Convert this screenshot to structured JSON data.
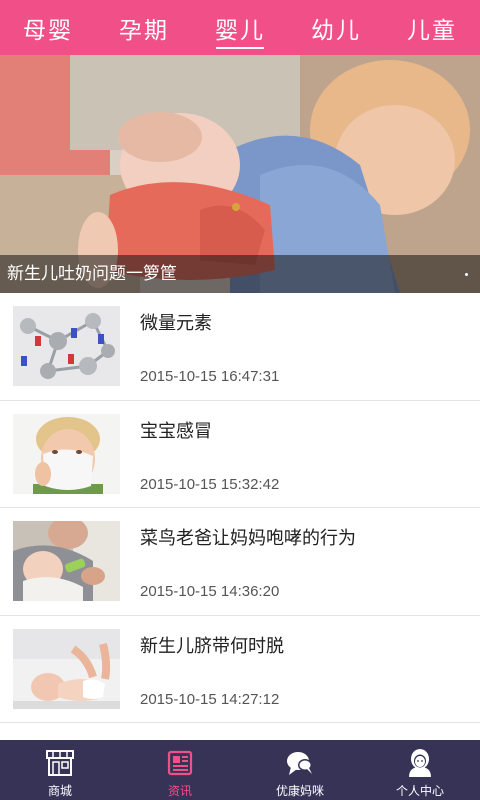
{
  "top_tabs": [
    {
      "label": "母婴"
    },
    {
      "label": "孕期"
    },
    {
      "label": "婴儿"
    },
    {
      "label": "幼儿"
    },
    {
      "label": "儿童"
    }
  ],
  "active_top_tab": "婴儿",
  "hero": {
    "caption": "新生儿吐奶问题一箩筐",
    "slide_indicator": "•"
  },
  "articles": [
    {
      "title": "微量元素",
      "time": "2015-10-15 16:47:31",
      "thumb_icon": "molecule-model-image"
    },
    {
      "title": "宝宝感冒",
      "time": "2015-10-15 15:32:42",
      "thumb_icon": "child-blowing-nose-image"
    },
    {
      "title": "菜鸟老爸让妈妈咆哮的行为",
      "time": "2015-10-15 14:36:20",
      "thumb_icon": "dad-bottle-feeding-image"
    },
    {
      "title": "新生儿脐带何时脱",
      "time": "2015-10-15 14:27:12",
      "thumb_icon": "newborn-diaper-change-image"
    }
  ],
  "bottom_tabs": [
    {
      "label": "商城",
      "icon": "shop-icon"
    },
    {
      "label": "资讯",
      "icon": "news-icon"
    },
    {
      "label": "优康妈咪",
      "icon": "chat-bubble-icon"
    },
    {
      "label": "个人中心",
      "icon": "user-avatar-icon"
    }
  ],
  "active_bottom_tab": "资讯",
  "colors": {
    "brand_pink": "#f14f87",
    "bottom_bar": "#363357"
  }
}
